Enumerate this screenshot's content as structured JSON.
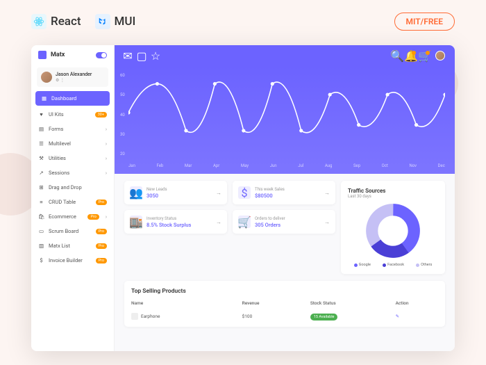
{
  "header": {
    "react": "React",
    "mui": "MUI",
    "license": "MIT/FREE"
  },
  "sidebar": {
    "brand": "Matx",
    "user": {
      "name": "Jason Alexander"
    },
    "items": [
      {
        "label": "Dashboard",
        "icon": "dashboard"
      },
      {
        "label": "UI Kits",
        "icon": "heart",
        "badge": "30+"
      },
      {
        "label": "Forms",
        "icon": "document"
      },
      {
        "label": "Multilevel",
        "icon": "layers"
      },
      {
        "label": "Utilities",
        "icon": "tools"
      },
      {
        "label": "Sessions",
        "icon": "arrow"
      },
      {
        "label": "Drag and Drop",
        "icon": "grid"
      },
      {
        "label": "CRUD Table",
        "icon": "list",
        "badge": "Pro"
      },
      {
        "label": "Ecommerce",
        "icon": "bag",
        "badge": "Pro"
      },
      {
        "label": "Scrum Board",
        "icon": "board",
        "badge": "Pro"
      },
      {
        "label": "Matx List",
        "icon": "list2",
        "badge": "Pro"
      },
      {
        "label": "Invoice Builder",
        "icon": "invoice",
        "badge": "Pro"
      }
    ]
  },
  "chart_data": {
    "type": "line",
    "x": [
      "Jan",
      "Feb",
      "Mar",
      "Apr",
      "May",
      "Jun",
      "Jul",
      "Aug",
      "Sep",
      "Oct",
      "Nov",
      "Dec"
    ],
    "values": [
      40,
      55,
      30,
      55,
      30,
      55,
      30,
      50,
      33,
      50,
      33,
      50
    ],
    "ylim": [
      20,
      60
    ],
    "yticks": [
      60,
      50,
      40,
      30,
      20
    ],
    "title": "",
    "xlabel": "",
    "ylabel": ""
  },
  "stats": [
    {
      "icon": "group",
      "label": "New Leads",
      "value": "3050"
    },
    {
      "icon": "attach_money",
      "label": "This week Sales",
      "value": "$80500"
    },
    {
      "icon": "store",
      "label": "Inventory Status",
      "value": "8.5% Stock Surplus"
    },
    {
      "icon": "shopping_cart",
      "label": "Orders to deliver",
      "value": "305 Orders"
    }
  ],
  "traffic": {
    "title": "Traffic Sources",
    "subtitle": "Last 30 days",
    "legend": [
      {
        "label": "Google",
        "color": "#6c63ff"
      },
      {
        "label": "Facebook",
        "color": "#4a3fd6"
      },
      {
        "label": "Others",
        "color": "#c5c0f5"
      }
    ]
  },
  "table": {
    "title": "Top Selling Products",
    "headers": {
      "name": "Name",
      "revenue": "Revenue",
      "stock": "Stock Status",
      "action": "Action"
    },
    "rows": [
      {
        "name": "Earphone",
        "revenue": "$100",
        "stock": "15 Available"
      }
    ]
  }
}
